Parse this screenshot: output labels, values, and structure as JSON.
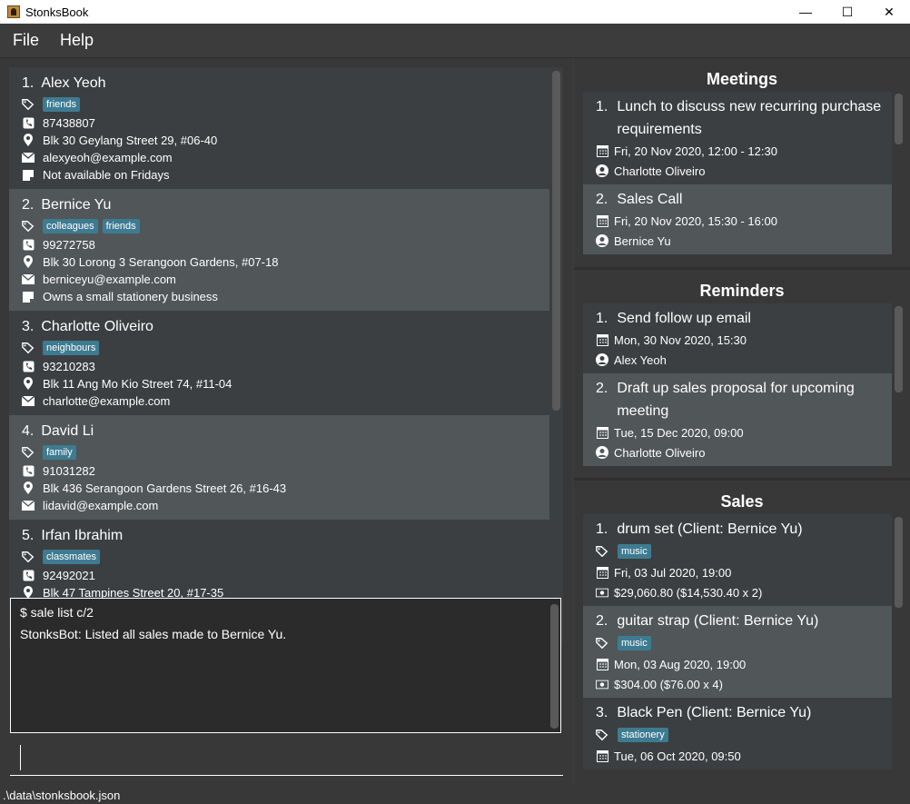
{
  "window": {
    "title": "StonksBook",
    "minimize": "—",
    "maximize": "☐",
    "close": "✕"
  },
  "menu": {
    "file": "File",
    "help": "Help"
  },
  "persons": [
    {
      "index": "1.",
      "name": "Alex Yeoh",
      "tags": [
        "friends"
      ],
      "phone": "87438807",
      "address": "Blk 30 Geylang Street 29, #06-40",
      "email": "alexyeoh@example.com",
      "remark": "Not available on Fridays"
    },
    {
      "index": "2.",
      "name": "Bernice Yu",
      "tags": [
        "colleagues",
        "friends"
      ],
      "phone": "99272758",
      "address": "Blk 30 Lorong 3 Serangoon Gardens, #07-18",
      "email": "berniceyu@example.com",
      "remark": "Owns a small stationery business"
    },
    {
      "index": "3.",
      "name": "Charlotte Oliveiro",
      "tags": [
        "neighbours"
      ],
      "phone": "93210283",
      "address": "Blk 11 Ang Mo Kio Street 74, #11-04",
      "email": "charlotte@example.com",
      "remark": ""
    },
    {
      "index": "4.",
      "name": "David Li",
      "tags": [
        "family"
      ],
      "phone": "91031282",
      "address": "Blk 436 Serangoon Gardens Street 26, #16-43",
      "email": "lidavid@example.com",
      "remark": ""
    },
    {
      "index": "5.",
      "name": "Irfan Ibrahim",
      "tags": [
        "classmates"
      ],
      "phone": "92492021",
      "address": "Blk 47 Tampines Street 20, #17-35",
      "email": "",
      "remark": ""
    }
  ],
  "result": {
    "command": "$ sale list c/2",
    "response": "StonksBot: Listed all sales made to Bernice Yu."
  },
  "command_box": {
    "value": ""
  },
  "meetings": {
    "title": "Meetings",
    "items": [
      {
        "index": "1.",
        "title": "Lunch to discuss new recurring purchase requirements",
        "time": "Fri, 20 Nov 2020, 12:00 - 12:30",
        "person": "Charlotte Oliveiro"
      },
      {
        "index": "2.",
        "title": "Sales Call",
        "time": "Fri, 20 Nov 2020, 15:30 - 16:00",
        "person": "Bernice Yu"
      }
    ]
  },
  "reminders": {
    "title": "Reminders",
    "items": [
      {
        "index": "1.",
        "title": "Send follow up email",
        "time": "Mon, 30 Nov 2020, 15:30",
        "person": "Alex Yeoh"
      },
      {
        "index": "2.",
        "title": "Draft up sales proposal for upcoming meeting",
        "time": "Tue, 15 Dec 2020, 09:00",
        "person": "Charlotte Oliveiro"
      }
    ]
  },
  "sales": {
    "title": "Sales",
    "items": [
      {
        "index": "1.",
        "title": "drum set (Client: Bernice Yu)",
        "tag": "music",
        "time": "Fri, 03 Jul 2020, 19:00",
        "price": "$29,060.80 ($14,530.40 x 2)"
      },
      {
        "index": "2.",
        "title": "guitar strap (Client: Bernice Yu)",
        "tag": "music",
        "time": "Mon, 03 Aug 2020, 19:00",
        "price": "$304.00 ($76.00 x 4)"
      },
      {
        "index": "3.",
        "title": "Black Pen (Client: Bernice Yu)",
        "tag": "stationery",
        "time": "Tue, 06 Oct 2020, 09:50",
        "price": ""
      }
    ]
  },
  "status": {
    "file_path": ".\\data\\stonksbook.json"
  },
  "colors": {
    "tag": "#3e7b91",
    "background": "#383838",
    "card_dark": "#3c3f41",
    "card_light": "#515658"
  }
}
